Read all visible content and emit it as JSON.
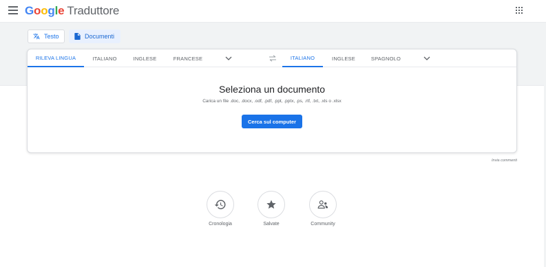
{
  "header": {
    "brand_google": "Google",
    "brand_product": "Traduttore",
    "brand_colors": [
      "#4285f4",
      "#ea4335",
      "#fbbc05",
      "#4285f4",
      "#34a853",
      "#ea4335"
    ]
  },
  "modes": [
    {
      "label": "Testo",
      "icon": "translate-icon",
      "active": false
    },
    {
      "label": "Documenti",
      "icon": "document-icon",
      "active": true
    }
  ],
  "source_languages": [
    {
      "label": "RILEVA LINGUA",
      "active": true
    },
    {
      "label": "ITALIANO",
      "active": false
    },
    {
      "label": "INGLESE",
      "active": false
    },
    {
      "label": "FRANCESE",
      "active": false
    }
  ],
  "target_languages": [
    {
      "label": "ITALIANO",
      "active": true
    },
    {
      "label": "INGLESE",
      "active": false
    },
    {
      "label": "SPAGNOLO",
      "active": false
    }
  ],
  "document": {
    "title": "Seleziona un documento",
    "subtitle": "Carica un file .doc, .docx, .odf, .pdf, .ppt, .pptx, .ps, .rtf, .txt, .xls o .xlsx",
    "button": "Cerca sul computer"
  },
  "feedback": "Invia commenti",
  "actions": [
    {
      "label": "Cronologia",
      "icon": "history-icon"
    },
    {
      "label": "Salvate",
      "icon": "star-icon"
    },
    {
      "label": "Community",
      "icon": "community-icon"
    }
  ],
  "colors": {
    "accent": "#1a73e8",
    "band": "#f1f3f4",
    "text": "#5f6368"
  }
}
